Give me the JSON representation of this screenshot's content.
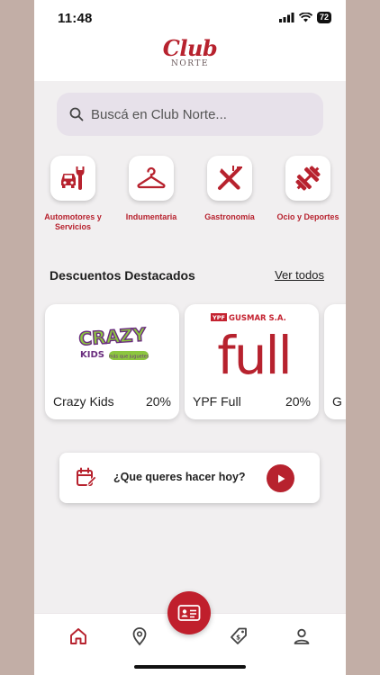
{
  "status_bar": {
    "time": "11:48",
    "battery": "72"
  },
  "header": {
    "logo_club": "Club",
    "logo_norte": "NORTE"
  },
  "search": {
    "placeholder": "Buscá en Club Norte..."
  },
  "categories": [
    {
      "label": "Automotores y Servicios",
      "icon": "car-wrench-icon"
    },
    {
      "label": "Indumentaria",
      "icon": "hanger-icon"
    },
    {
      "label": "Gastronomía",
      "icon": "fork-knife-icon"
    },
    {
      "label": "Ocio y Deportes",
      "icon": "dumbbell-icon"
    }
  ],
  "featured": {
    "title": "Descuentos Destacados",
    "see_all": "Ver todos",
    "cards": [
      {
        "name": "Crazy Kids",
        "discount": "20%",
        "logo_text": "CRAZY",
        "logo_sub": "KIDS",
        "logo_tag": "más que juguetes"
      },
      {
        "name": "YPF Full",
        "discount": "20%",
        "logo_text": "full",
        "logo_badge": "YPF",
        "logo_brand": "GUSMAR S.A."
      },
      {
        "name": "G"
      }
    ]
  },
  "cta": {
    "text": "¿Que queres hacer hoy?"
  },
  "colors": {
    "accent": "#b7222e",
    "background": "#f1eff0"
  },
  "nav": [
    "home-icon",
    "map-pin-icon",
    "id-card-icon",
    "tag-icon",
    "profile-icon"
  ]
}
